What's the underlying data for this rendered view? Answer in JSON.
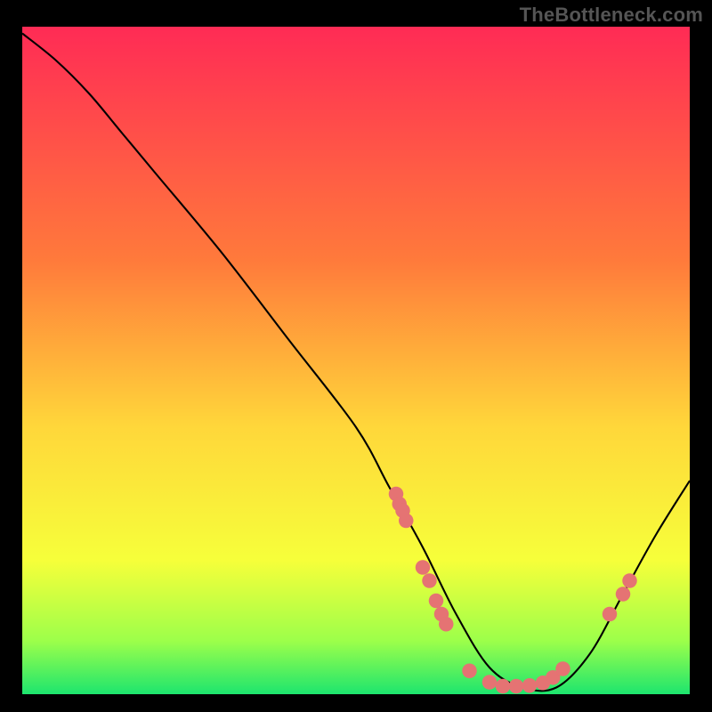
{
  "attribution": "TheBottleneck.com",
  "chart_data": {
    "type": "line",
    "title": "",
    "xlabel": "",
    "ylabel": "",
    "xlim": [
      0,
      100
    ],
    "ylim": [
      0,
      100
    ],
    "gradient_stops": [
      {
        "offset": 0,
        "color": "#ff2b55"
      },
      {
        "offset": 35,
        "color": "#ff7a3b"
      },
      {
        "offset": 60,
        "color": "#ffd73a"
      },
      {
        "offset": 80,
        "color": "#f6ff3a"
      },
      {
        "offset": 92,
        "color": "#9dff4a"
      },
      {
        "offset": 100,
        "color": "#1de56e"
      }
    ],
    "series": [
      {
        "name": "bottleneck-curve",
        "x": [
          0,
          5,
          10,
          15,
          20,
          30,
          40,
          50,
          55,
          60,
          65,
          70,
          75,
          80,
          85,
          90,
          95,
          100
        ],
        "y": [
          99,
          95,
          90,
          84,
          78,
          66,
          53,
          40,
          31,
          22,
          12,
          4,
          1,
          1,
          6,
          15,
          24,
          32
        ]
      }
    ],
    "marker_clusters": [
      {
        "name": "left-upper",
        "points": [
          [
            56,
            30
          ],
          [
            56.5,
            28.5
          ],
          [
            57,
            27.5
          ],
          [
            57.5,
            26
          ]
        ]
      },
      {
        "name": "left-lower",
        "points": [
          [
            60,
            19
          ],
          [
            61,
            17
          ],
          [
            62,
            14
          ],
          [
            62.8,
            12
          ],
          [
            63.5,
            10.5
          ]
        ]
      },
      {
        "name": "valley",
        "points": [
          [
            67,
            3.5
          ],
          [
            70,
            1.8
          ],
          [
            72,
            1.2
          ],
          [
            74,
            1.2
          ],
          [
            76,
            1.3
          ],
          [
            78,
            1.7
          ],
          [
            79.5,
            2.5
          ],
          [
            81,
            3.8
          ]
        ]
      },
      {
        "name": "right",
        "points": [
          [
            88,
            12
          ],
          [
            90,
            15
          ],
          [
            91,
            17
          ]
        ]
      }
    ],
    "marker_color": "#e57373",
    "marker_radius": 1.1
  }
}
